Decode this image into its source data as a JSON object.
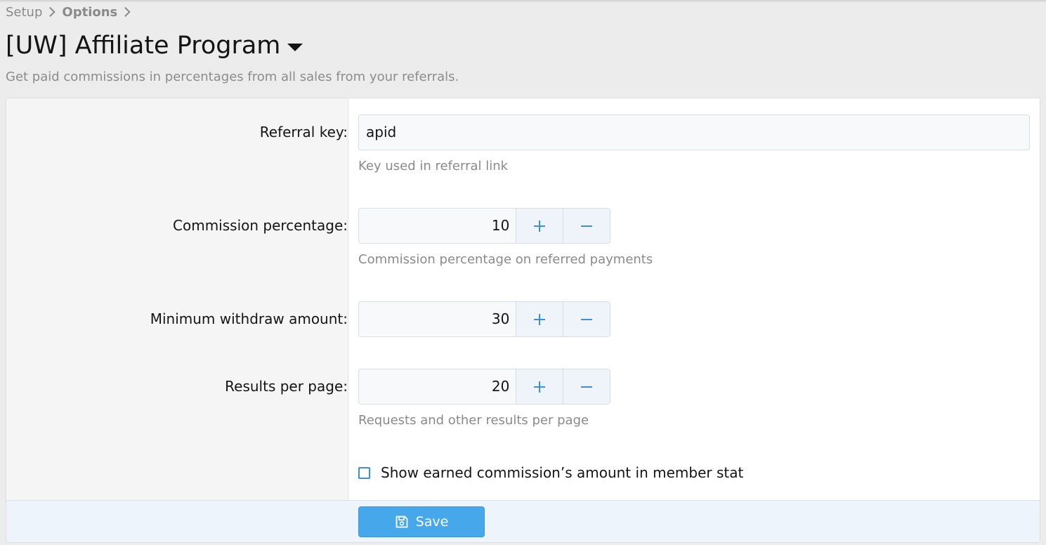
{
  "breadcrumb": {
    "items": [
      "Setup",
      "Options"
    ]
  },
  "page": {
    "title": "[UW] Affiliate Program",
    "description": "Get paid commissions in percentages from all sales from your referrals."
  },
  "form": {
    "referral_key": {
      "label": "Referral key:",
      "value": "apid",
      "hint": "Key used in referral link"
    },
    "commission_percentage": {
      "label": "Commission percentage:",
      "value": "10",
      "hint": "Commission percentage on referred payments"
    },
    "min_withdraw": {
      "label": "Minimum withdraw amount:",
      "value": "30"
    },
    "results_per_page": {
      "label": "Results per page:",
      "value": "20",
      "hint": "Requests and other results per page"
    },
    "show_commission": {
      "label": "Show earned commission’s amount in member stat",
      "checked": false
    }
  },
  "footer": {
    "save_label": "Save"
  },
  "icons": {
    "title_menu": "caret-down-icon",
    "save": "save-icon",
    "increment": "plus-icon",
    "decrement": "minus-icon"
  },
  "colors": {
    "accent": "#47a7eb",
    "background": "#ececec",
    "label_column": "#f5f5f5"
  }
}
